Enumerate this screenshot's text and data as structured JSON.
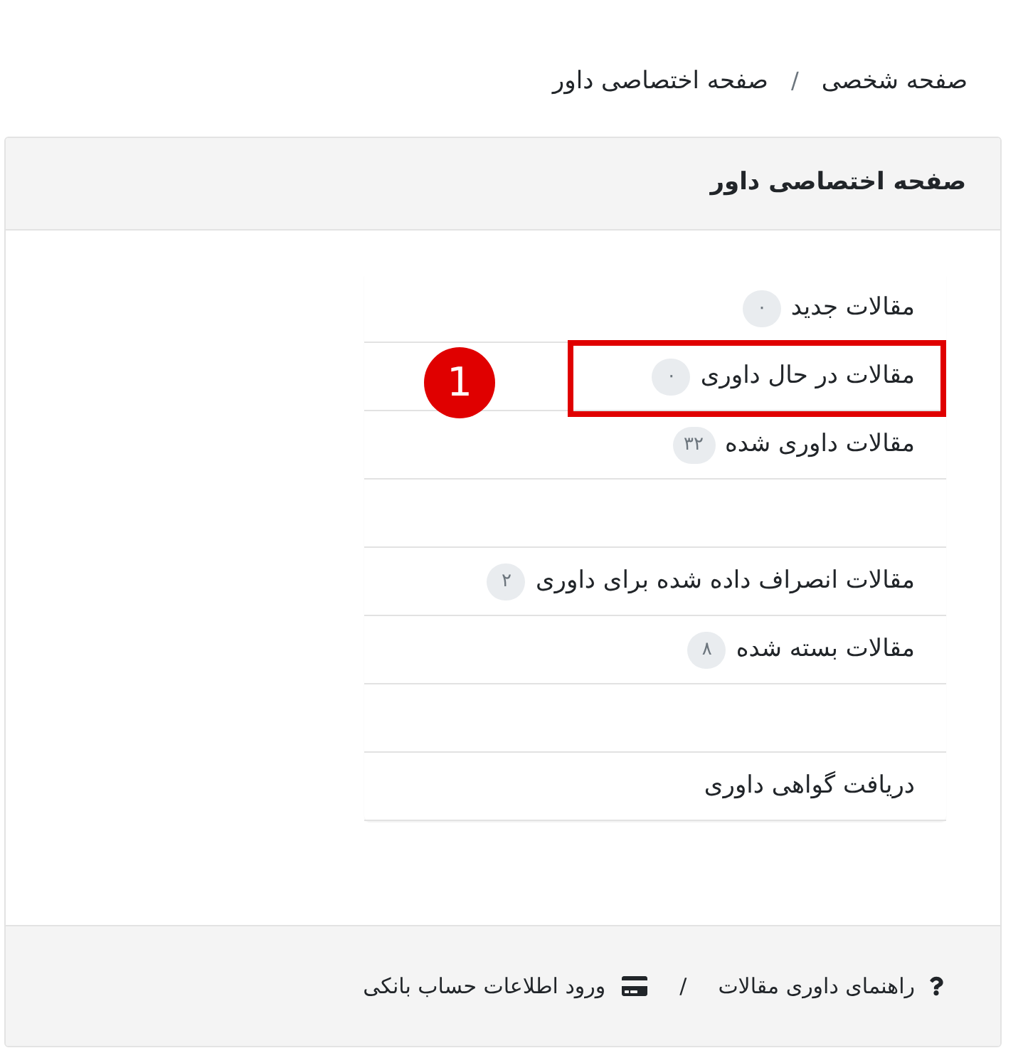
{
  "breadcrumb": {
    "items": [
      {
        "label": "صفحه شخصی"
      },
      {
        "label": "صفحه اختصاصی داور"
      }
    ],
    "separator": "/"
  },
  "card": {
    "title": "صفحه اختصاصی داور"
  },
  "items": [
    {
      "kind": "link",
      "label": "مقالات جدید",
      "count": "۰",
      "highlighted": false
    },
    {
      "kind": "link",
      "label": "مقالات در حال داوری",
      "count": "۰",
      "highlighted": true,
      "marker": "1"
    },
    {
      "kind": "link",
      "label": "مقالات داوری شده",
      "count": "۳۲",
      "highlighted": false
    },
    {
      "kind": "empty"
    },
    {
      "kind": "link",
      "label": "مقالات انصراف داده شده برای داوری",
      "count": "۲",
      "highlighted": false
    },
    {
      "kind": "link",
      "label": "مقالات بسته شده",
      "count": "۸",
      "highlighted": false
    },
    {
      "kind": "empty"
    },
    {
      "kind": "link",
      "label": "دریافت گواهی داوری",
      "highlighted": false
    }
  ],
  "footer": {
    "links": [
      {
        "kind": "help",
        "label": "راهنمای داوری مقالات"
      },
      {
        "kind": "payment",
        "label": "ورود اطلاعات حساب بانکی"
      }
    ],
    "separator": "/"
  }
}
